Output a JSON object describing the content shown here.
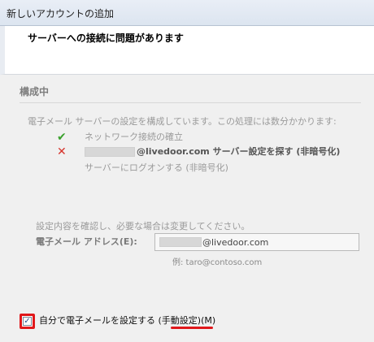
{
  "window": {
    "title": "新しいアカウントの追加"
  },
  "header": {
    "heading": "サーバーへの接続に問題があります"
  },
  "section": {
    "title": "構成中",
    "description": "電子メール サーバーの設定を構成しています。この処理には数分かかります:"
  },
  "steps": [
    {
      "status": "success",
      "icon": "checkmark-icon",
      "label": "ネットワーク接続の確立"
    },
    {
      "status": "error",
      "icon": "cross-icon",
      "email_domain": "@livedoor.com",
      "label": "サーバー設定を探す (非暗号化)"
    },
    {
      "status": "pending",
      "label": "サーバーにログオンする (非暗号化)"
    }
  ],
  "confirm_text": "設定内容を確認し、必要な場合は変更してください。",
  "email": {
    "label": "電子メール アドレス(E):",
    "domain": "@livedoor.com",
    "example": "例: taro@contoso.com"
  },
  "manual": {
    "checked": true,
    "label_prefix": "自分で電子メールを設定する (",
    "label_emph": "手動設定",
    "label_suffix": ")(M)"
  },
  "colors": {
    "success": "#3aa12d",
    "error": "#d6332b",
    "highlight": "#e0181b"
  }
}
